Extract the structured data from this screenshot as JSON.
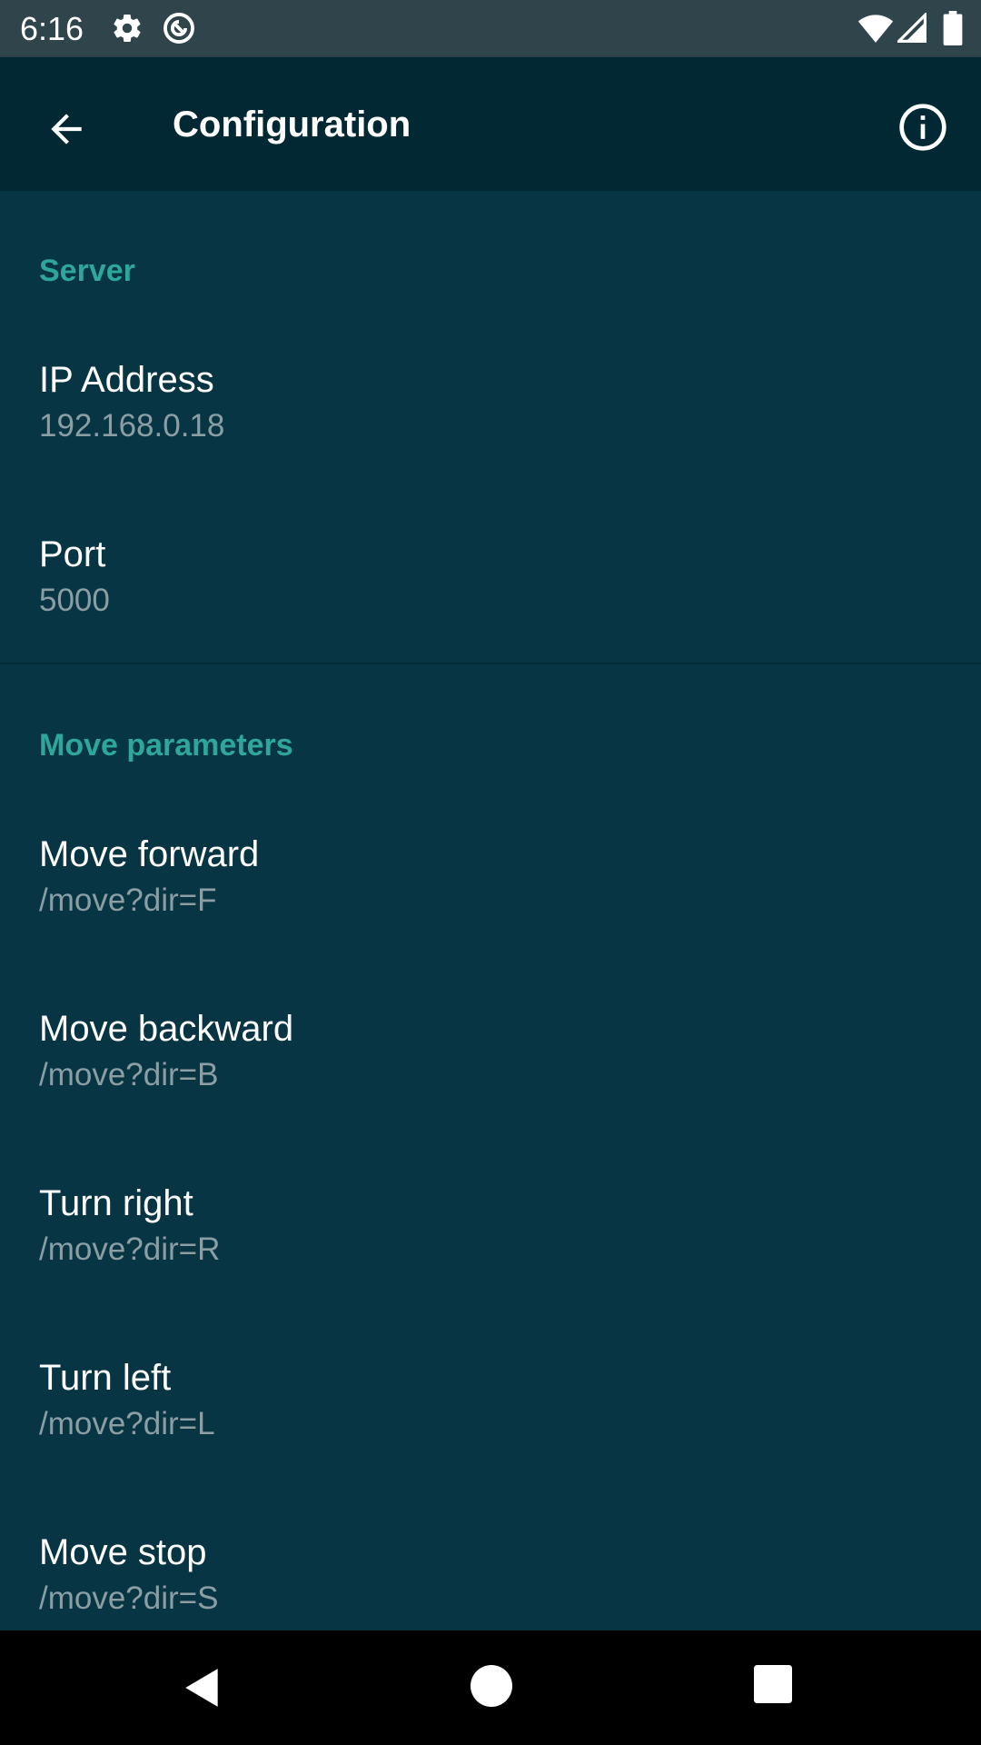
{
  "status_bar": {
    "time": "6:16",
    "icons": [
      "gear-icon",
      "dnd-icon",
      "wifi-icon",
      "signal-icon",
      "battery-icon"
    ]
  },
  "app_bar": {
    "title": "Configuration",
    "back_icon": "arrow-back-icon",
    "info_icon": "info-icon"
  },
  "sections": [
    {
      "header": "Server",
      "items": [
        {
          "title": "IP Address",
          "summary": "192.168.0.18"
        },
        {
          "title": "Port",
          "summary": "5000"
        }
      ]
    },
    {
      "header": "Move parameters",
      "items": [
        {
          "title": "Move forward",
          "summary": "/move?dir=F"
        },
        {
          "title": "Move backward",
          "summary": "/move?dir=B"
        },
        {
          "title": "Turn right",
          "summary": "/move?dir=R"
        },
        {
          "title": "Turn left",
          "summary": "/move?dir=L"
        },
        {
          "title": "Move stop",
          "summary": "/move?dir=S"
        }
      ]
    }
  ],
  "nav_bar": {
    "icons": [
      "nav-back-icon",
      "nav-home-icon",
      "nav-recents-icon"
    ]
  },
  "colors": {
    "accent": "#2ea79a",
    "background": "#083544",
    "app_bar": "#022834",
    "status_bar": "#2f444b"
  }
}
